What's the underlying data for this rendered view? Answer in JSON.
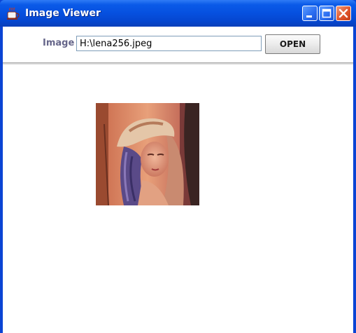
{
  "window": {
    "title": "Image Viewer",
    "app_icon": "java-cup-icon",
    "controls": [
      "minimize-icon",
      "maximize-icon",
      "close-icon"
    ],
    "colors": {
      "titlebar": "#0650df",
      "close_button": "#e0562d",
      "label": "#66668a"
    }
  },
  "toolbar": {
    "image_label": "Image",
    "path_value": "H:\\lena256.jpeg",
    "open_label": "OPEN"
  },
  "viewer": {
    "image_description_icon": "portrait-photo"
  }
}
